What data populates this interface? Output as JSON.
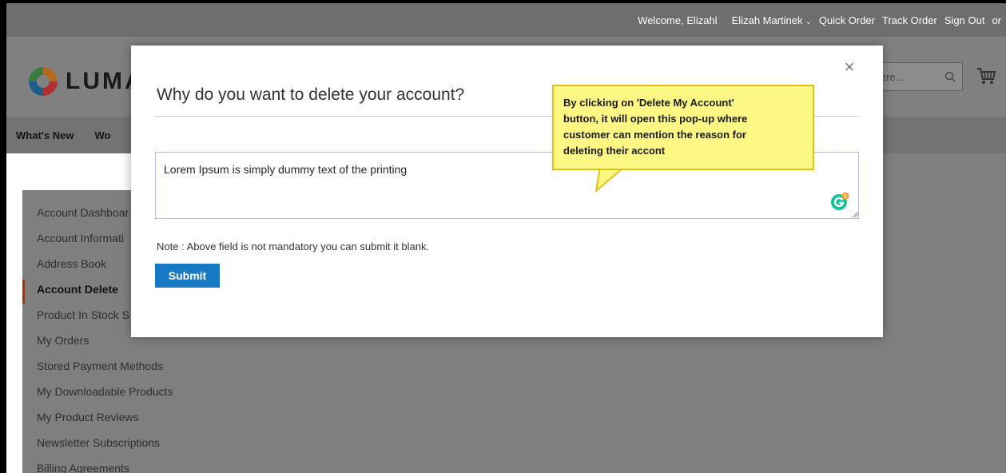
{
  "topbar": {
    "welcome": "Welcome, Elizahl",
    "user_name": "Elizah Martinek",
    "quick_order": "Quick Order",
    "track_order": "Track Order",
    "sign_out": "Sign Out",
    "or": "or"
  },
  "header": {
    "logo_text": "LUMA",
    "search_placeholder": "ere...",
    "search_icon": "search-icon",
    "cart_icon": "cart-icon"
  },
  "nav": {
    "items": [
      "What's New",
      "Wo"
    ]
  },
  "sidebar": {
    "items": [
      {
        "label": "Account Dashboar"
      },
      {
        "label": "Account Informati"
      },
      {
        "label": "Address Book"
      },
      {
        "label": "Account Delete"
      },
      {
        "label": "Product In Stock S"
      },
      {
        "label": "My Orders"
      },
      {
        "label": "Stored Payment Methods"
      },
      {
        "label": "My Downloadable Products"
      },
      {
        "label": "My Product Reviews"
      },
      {
        "label": "Newsletter Subscriptions"
      },
      {
        "label": "Billing Agreements"
      }
    ],
    "active_index": 3,
    "active_accent_color": "#8a3d16"
  },
  "modal": {
    "title": "Why do you want to delete your account?",
    "close_symbol": "×",
    "reason_value": "Lorem Ipsum is simply dummy text of the printing",
    "note": "Note : Above field is not mandatory you can submit it blank.",
    "submit_label": "Submit",
    "submit_color": "#1979c3"
  },
  "callout": {
    "lines": [
      "By clicking on 'Delete My Account'",
      "button, it will open this pop-up where",
      "customer can mention the reason for",
      "deleting their accont"
    ],
    "background": "#fdf783"
  }
}
